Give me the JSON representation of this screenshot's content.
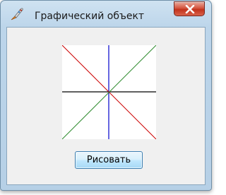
{
  "window": {
    "title": "Графический объект",
    "app_icon": "rocket-brush-icon",
    "close_icon": "close-icon"
  },
  "main": {
    "draw_button_label": "Рисовать"
  },
  "canvas": {
    "lines": [
      {
        "name": "horizontal-axis",
        "color": "#000000"
      },
      {
        "name": "vertical-axis",
        "color": "#0000cc"
      },
      {
        "name": "diagonal-down",
        "color": "#cc0000"
      },
      {
        "name": "diagonal-up",
        "color": "#2e8b2e"
      }
    ]
  }
}
